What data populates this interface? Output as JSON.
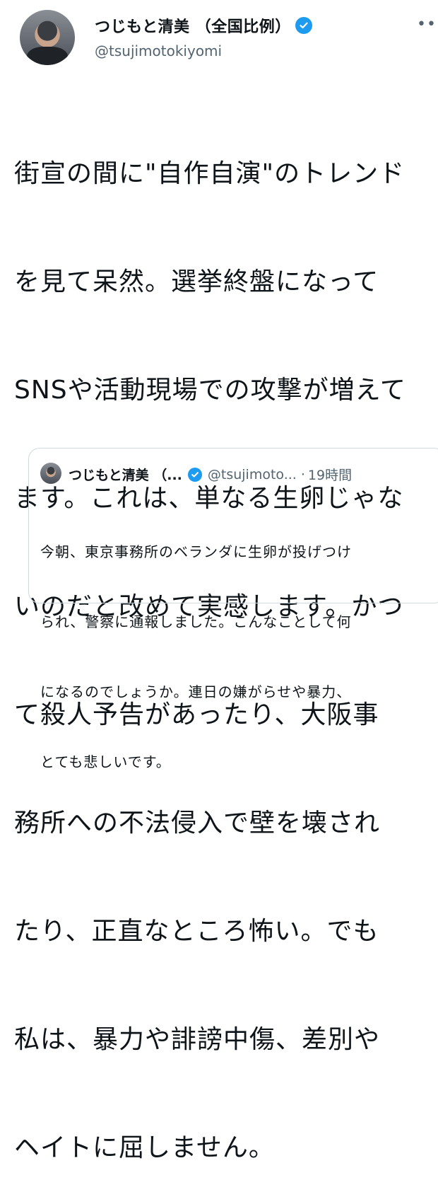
{
  "author": {
    "name": "つじもと清美 （全国比例）",
    "handle": "@tsujimotokiyomi",
    "avatar_icon": "profile-photo",
    "verified_icon": "verified-badge-icon",
    "more_icon": "more-options-icon",
    "more_label": "•••"
  },
  "tweet": {
    "lines": [
      "街宣の間に\"自作自演\"のトレンド",
      "を見て呆然。選挙終盤になって",
      "SNSや活動現場での攻撃が増えて",
      "ます。これは、単なる生卵じゃな",
      "いのだと改めて実感します。かつ",
      "て殺人予告があったり、大阪事",
      "務所への不法侵入で壁を壊され",
      "たり、正直なところ怖い。でも",
      "私は、暴力や誹謗中傷、差別や",
      "ヘイトに屈しません。"
    ]
  },
  "quoted_tweet": {
    "name": "つじもと清美 （...",
    "handle": "@tsujimoto...",
    "separator": "·",
    "time": "19時間",
    "lines": [
      "今朝、東京事務所のベランダに生卵が投げつけ",
      "られ、警察に通報しました。こんなことして何",
      "になるのでしょうか。連日の嫌がらせや暴力、",
      "とても悲しいです。"
    ]
  },
  "colors": {
    "accent": "#1d9bf0",
    "text": "#0f1419",
    "secondary_text": "#536471",
    "border": "#cfd9de"
  }
}
